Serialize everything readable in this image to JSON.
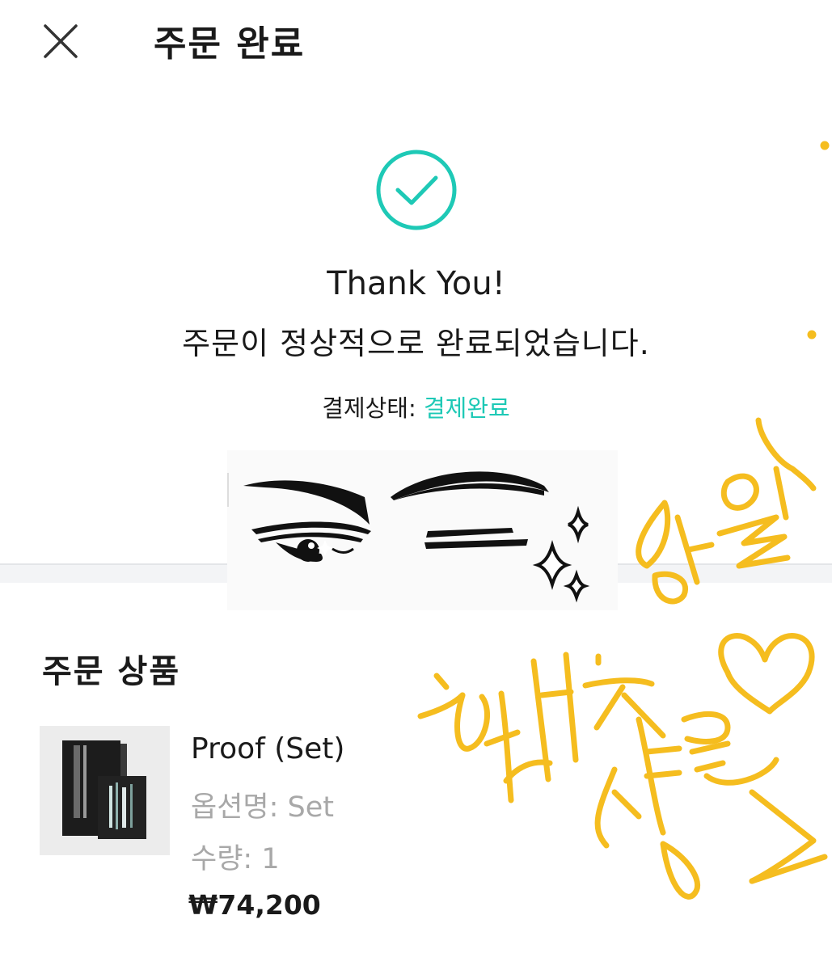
{
  "header": {
    "title": "주문 완료"
  },
  "confirmation": {
    "thank_you": "Thank You!",
    "message": "주문이 정상적으로 완료되었습니다.",
    "payment_label": "결제상태: ",
    "payment_status": "결제완료"
  },
  "order_items": {
    "section_title": "주문 상품",
    "items": [
      {
        "name": "Proof (Set)",
        "option": "옵션명: Set",
        "quantity": "수량: 1",
        "price": "₩74,200"
      }
    ]
  },
  "overlay": {
    "handwriting": "생일 축하 선물",
    "color": "#f5bd1f"
  },
  "colors": {
    "accent": "#1ec9b6",
    "muted_text": "#a8a8a8"
  },
  "icons": [
    "close-icon",
    "check-circle-icon"
  ]
}
